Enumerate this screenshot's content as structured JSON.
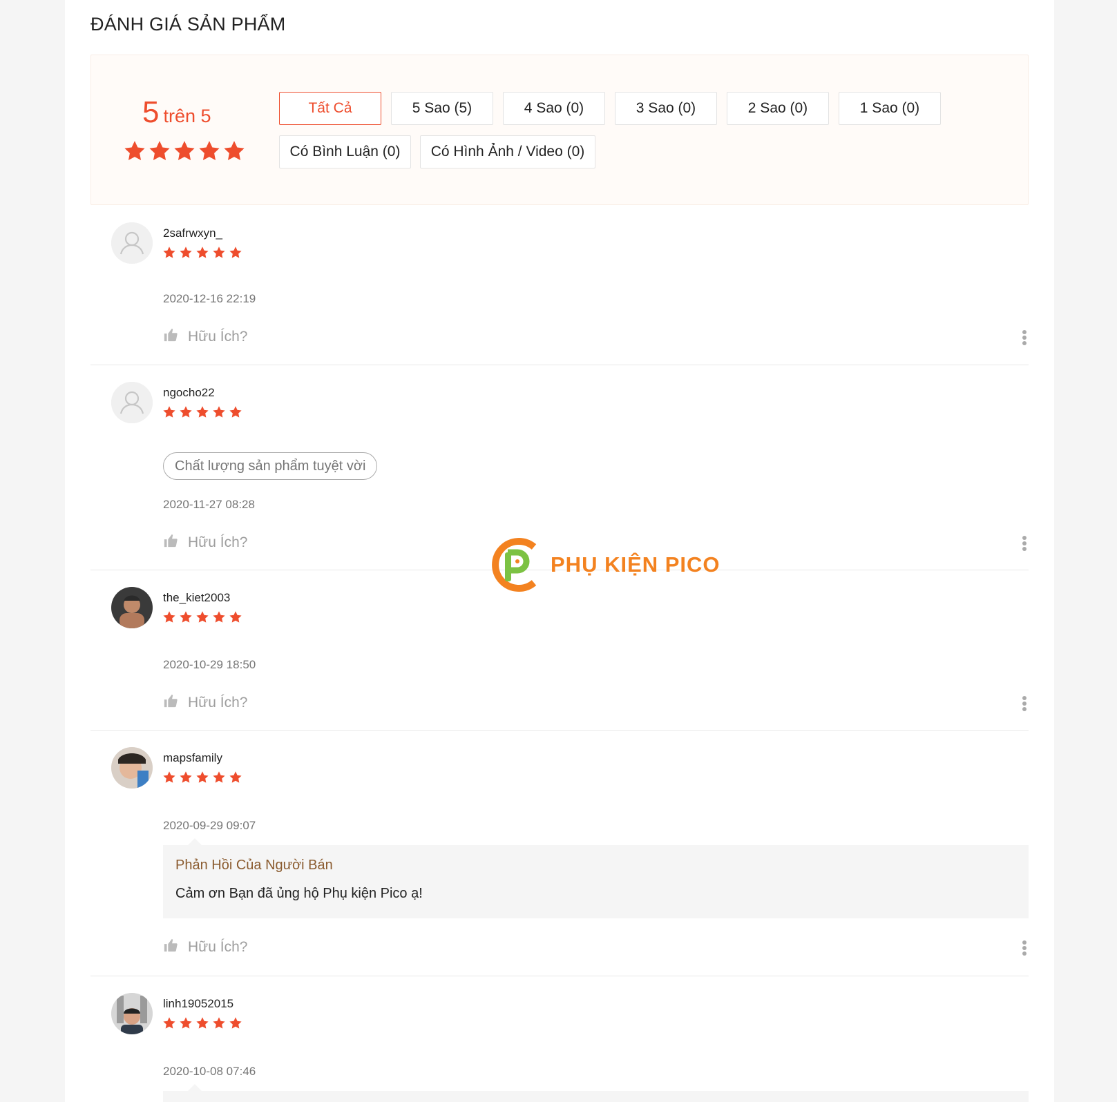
{
  "section_title": "ĐÁNH GIÁ SẢN PHẨM",
  "overview": {
    "score": "5",
    "score_suffix": "trên 5",
    "stars": 5,
    "filters": [
      "Tất Cả",
      "5 Sao (5)",
      "4 Sao (0)",
      "3 Sao (0)",
      "2 Sao (0)",
      "1 Sao (0)",
      "Có Bình Luận (0)",
      "Có Hình Ảnh / Video (0)"
    ],
    "active_filter": "Tất Cả"
  },
  "helpful_label": "Hữu Ích?",
  "reviews": [
    {
      "author": "2safrwxyn_",
      "rating": 5,
      "time": "2020-12-16 22:19",
      "avatar": "default-avatar-icon"
    },
    {
      "author": "ngocho22",
      "rating": 5,
      "tag": "Chất lượng sản phẩm tuyệt vời",
      "time": "2020-11-27 08:28",
      "avatar": "default-avatar-icon"
    },
    {
      "author": "the_kiet2003",
      "rating": 5,
      "time": "2020-10-29 18:50",
      "avatar": "user-photo"
    },
    {
      "author": "mapsfamily",
      "rating": 5,
      "time": "2020-09-29 09:07",
      "avatar": "user-photo",
      "reply": {
        "title": "Phản Hồi Của Người Bán",
        "text": "Cảm ơn Bạn đã ủng hộ Phụ kiện Pico ạ!"
      }
    },
    {
      "author": "linh19052015",
      "rating": 5,
      "time": "2020-10-08 07:46",
      "avatar": "user-photo"
    }
  ],
  "watermark": {
    "text": "PHỤ KIỆN PICO"
  },
  "colors": {
    "accent": "#ee4d2d",
    "reply_title": "#8a5b2f",
    "watermark_orange": "#f38220",
    "watermark_green": "#7cc243"
  }
}
